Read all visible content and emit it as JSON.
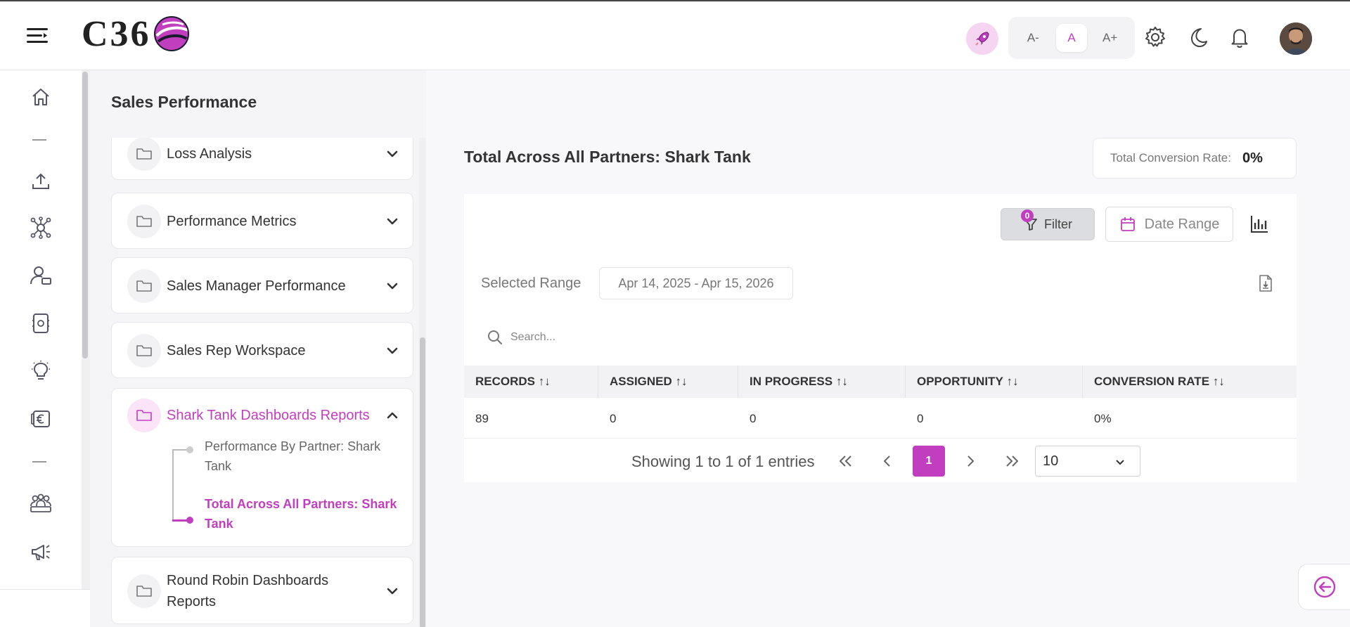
{
  "header": {
    "logo_text": "C36",
    "font_buttons": [
      "A-",
      "A",
      "A+"
    ],
    "active_font_index": 1
  },
  "page": {
    "title": "Sales Performance"
  },
  "accordion": [
    {
      "label": "Loss Analysis",
      "expanded": false
    },
    {
      "label": "Performance Metrics",
      "expanded": false
    },
    {
      "label": "Sales Manager Performance",
      "expanded": false
    },
    {
      "label": "Sales Rep Workspace",
      "expanded": false
    },
    {
      "label": "Shark Tank Dashboards Reports",
      "expanded": true,
      "items": [
        {
          "label": "Performance By Partner: Shark Tank",
          "active": false
        },
        {
          "label": "Total Across All Partners: Shark Tank",
          "active": true
        }
      ]
    },
    {
      "label": "Round Robin Dashboards Reports",
      "expanded": false
    }
  ],
  "report": {
    "title": "Total Across All Partners: Shark Tank",
    "conversion_label": "Total Conversion Rate:",
    "conversion_value": "0%",
    "filter_label": "Filter",
    "filter_count": "0",
    "date_range_label": "Date Range",
    "selected_range_label": "Selected Range",
    "selected_range_value": "Apr 14, 2025 - Apr 15, 2026",
    "search_placeholder": "Search...",
    "columns": [
      "RECORDS",
      "ASSIGNED",
      "IN PROGRESS",
      "OPPORTUNITY",
      "CONVERSION RATE"
    ],
    "sort_glyph": "↑↓",
    "rows": [
      [
        "89",
        "0",
        "0",
        "0",
        "0%"
      ]
    ],
    "pagination": {
      "summary": "Showing 1 to 1 of 1 entries",
      "current_page": "1",
      "page_size": "10"
    }
  },
  "colors": {
    "accent": "#c13fbf",
    "accent_light": "#fbe3f8"
  }
}
